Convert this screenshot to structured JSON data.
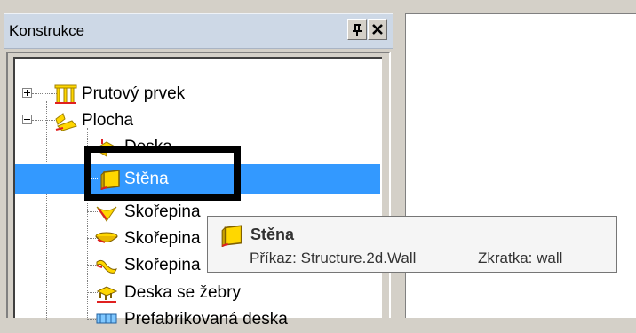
{
  "panel": {
    "title": "Konstrukce",
    "pin_icon": "pin-icon",
    "close_icon": "close-icon"
  },
  "tree": {
    "items": [
      {
        "label": "Prutový prvek",
        "icon": "member-icon",
        "expander": "+"
      },
      {
        "label": "Plocha",
        "icon": "plane-icon",
        "expander": "-"
      },
      {
        "label": "Deska",
        "icon": "slab-icon"
      },
      {
        "label": "Stěna",
        "icon": "wall-icon",
        "selected": true
      },
      {
        "label": "Skořepina",
        "icon": "shell-icon"
      },
      {
        "label": "Skořepina",
        "icon": "shell-bowl-icon"
      },
      {
        "label": "Skořepina",
        "icon": "shell-wave-icon"
      },
      {
        "label": "Deska se žebry",
        "icon": "ribbed-slab-icon"
      },
      {
        "label": "Prefabrikovaná deska",
        "icon": "precast-slab-icon"
      }
    ]
  },
  "tooltip": {
    "title": "Stěna",
    "command": "Příkaz: Structure.2d.Wall",
    "shortcut": "Zkratka: wall"
  },
  "colors": {
    "selection": "#3399ff",
    "header": "#cdd8e6",
    "highlight_frame": "#000000",
    "icon_yellow": "#ffd700",
    "icon_red": "#e02020"
  }
}
